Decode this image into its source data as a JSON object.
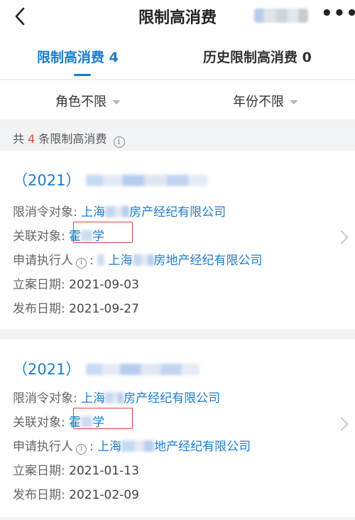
{
  "navbar": {
    "back_icon": "back-arrow-icon",
    "title": "限制高消费",
    "more_icon": "more-dots-icon",
    "more_label": "•••"
  },
  "tabs": [
    {
      "label": "限制高消费 4",
      "active": true
    },
    {
      "label": "历史限制高消费 0",
      "active": false
    }
  ],
  "filters": {
    "role": "角色不限",
    "year": "年份不限"
  },
  "summary": {
    "prefix": "共",
    "count": "4",
    "suffix": "条限制高消费"
  },
  "records": [
    {
      "title_prefix": "（2021）",
      "target_label": "限消令对象:",
      "target_value_a": "上海",
      "target_value_b": "房产经纪有限公司",
      "related_label": "关联对象:",
      "related_value_a": "霍",
      "related_value_b": "学",
      "applicant_label": "申请执行人",
      "applicant_value_a": "上海",
      "applicant_value_b": "房地产经纪有限公司",
      "filing_label": "立案日期:",
      "filing_date": "2021-09-03",
      "publish_label": "发布日期:",
      "publish_date": "2021-09-27"
    },
    {
      "title_prefix": "（2021）",
      "target_label": "限消令对象:",
      "target_value_a": "上海",
      "target_value_b": "房产经纪有限公司",
      "related_label": "关联对象:",
      "related_value_a": "霍",
      "related_value_b": "学",
      "applicant_label": "申请执行人",
      "applicant_value_a": "上海",
      "applicant_value_b": "地产经纪有限公司",
      "filing_label": "立案日期:",
      "filing_date": "2021-01-13",
      "publish_label": "发布日期:",
      "publish_date": "2021-02-09"
    }
  ],
  "colors": {
    "accent": "#1b7ccf",
    "count": "#e8473c",
    "highlight": "#e0403a"
  }
}
